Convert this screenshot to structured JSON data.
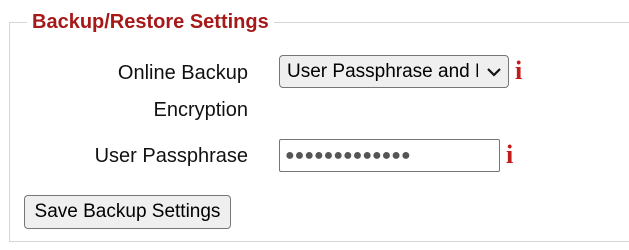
{
  "section": {
    "legend": "Backup/Restore Settings"
  },
  "encryption": {
    "label_line1": "Online Backup",
    "label_line2": "Encryption",
    "selected_value": "User Passphrase and Enterprise",
    "info_glyph": "i"
  },
  "passphrase": {
    "label": "User Passphrase",
    "masked_value": "●●●●●●●●●●●●●",
    "info_glyph": "i"
  },
  "actions": {
    "save_label": "Save Backup Settings"
  },
  "colors": {
    "legend": "#a71919",
    "info_icon": "#c31a1a"
  },
  "icons": {
    "select_arrow": "chevron-down-icon",
    "help": "info-icon"
  }
}
